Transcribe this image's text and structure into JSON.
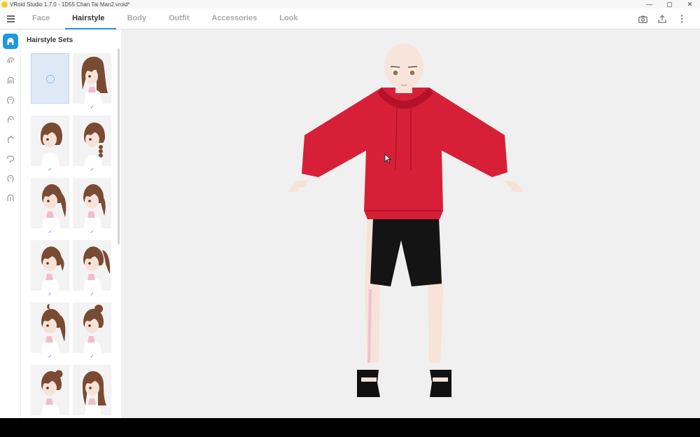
{
  "window": {
    "title": "VRoid Studio 1.7.0 - 1D55 Chan Tai Man2.vroid*",
    "controls": [
      "—",
      "▢",
      "✕"
    ]
  },
  "menu": {
    "tabs": [
      {
        "label": "Face",
        "active": false
      },
      {
        "label": "Hairstyle",
        "active": true
      },
      {
        "label": "Body",
        "active": false
      },
      {
        "label": "Outfit",
        "active": false
      },
      {
        "label": "Accessories",
        "active": false
      },
      {
        "label": "Look",
        "active": false
      }
    ],
    "actions": [
      "camera-icon",
      "export-icon",
      "more-vertical-icon"
    ]
  },
  "sidebar": {
    "icons": [
      "hairstyle-set-icon",
      "front-hair-icon",
      "base-hair-icon",
      "back-hair-icon",
      "side-hair-icon",
      "ahoge-icon",
      "extra-hair-icon",
      "hair-tips-icon",
      "hair-accessory-icon"
    ]
  },
  "panel": {
    "title": "Hairstyle Sets",
    "items": [
      {
        "name": "loading",
        "checked": false
      },
      {
        "name": "long-straight",
        "checked": true
      },
      {
        "name": "short-bob",
        "checked": true
      },
      {
        "name": "side-braid",
        "checked": true
      },
      {
        "name": "twin-tails",
        "checked": true
      },
      {
        "name": "low-ponytail",
        "checked": true
      },
      {
        "name": "side-ponytail",
        "checked": true
      },
      {
        "name": "high-ponytail",
        "checked": true
      },
      {
        "name": "ahoge-ponytail",
        "checked": true
      },
      {
        "name": "bun",
        "checked": true
      },
      {
        "name": "side-bun",
        "checked": false
      },
      {
        "name": "layered-long",
        "checked": false
      }
    ],
    "check_glyph": "✓"
  },
  "colors": {
    "accent": "#1f97e6",
    "hoodie": "#d81f38",
    "shorts": "#141414",
    "hair": "#7a4b33",
    "skin": "#f7e2d8"
  }
}
